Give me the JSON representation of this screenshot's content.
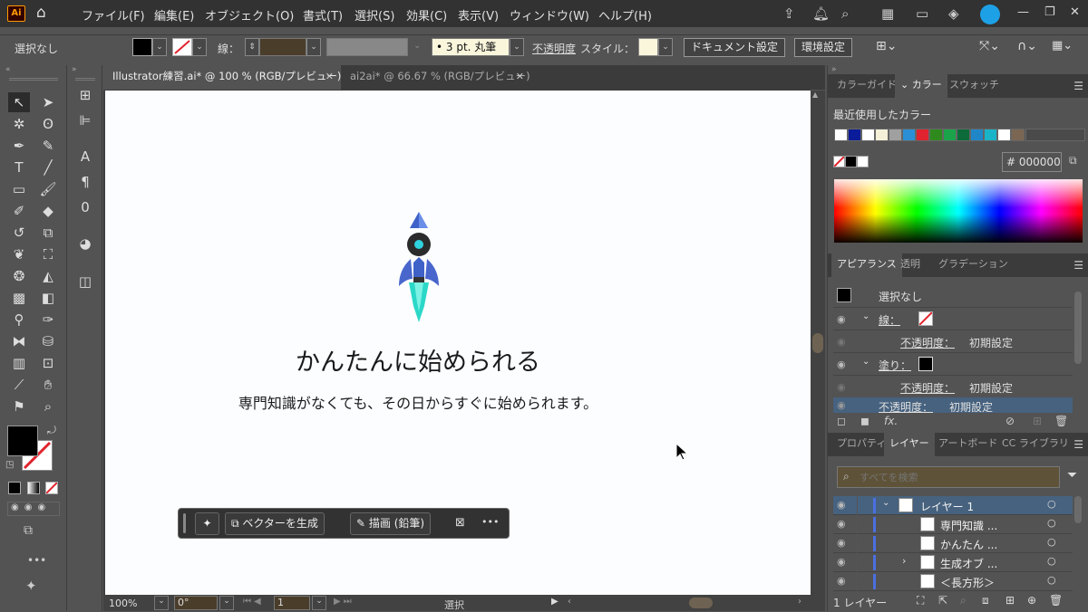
{
  "menubar": {
    "logo": "Ai",
    "items": [
      "ファイル(F)",
      "編集(E)",
      "オブジェクト(O)",
      "書式(T)",
      "選択(S)",
      "効果(C)",
      "表示(V)",
      "ウィンドウ(W)",
      "ヘルプ(H)"
    ],
    "icons": [
      "share-icon",
      "bell-icon",
      "search-icon",
      "workspace-icon",
      "arrange-icon",
      "plugin-icon",
      "profile-icon"
    ],
    "window_controls": [
      "—",
      "❐",
      "✕"
    ]
  },
  "control_bar": {
    "selection": "選択なし",
    "stroke_label": "線：",
    "stroke_size": "3 pt. 丸筆",
    "opacity_label": "不透明度",
    "style_label": "スタイル：",
    "doc_settings": "ドキュメント設定",
    "env_settings": "環境設定"
  },
  "tabs": [
    {
      "label": "Illustrator練習.ai* @ 100 % (RGB/プレビュー)",
      "active": true
    },
    {
      "label": "ai2ai* @ 66.67 % (RGB/プレビュー)",
      "active": false
    }
  ],
  "canvas": {
    "title": "かんたんに始められる",
    "subtitle": "専門知識がなくても、その日からすぐに始められます。"
  },
  "float_toolbar": {
    "generate_vector": "ベクターを生成",
    "draw_pencil": "描画 (鉛筆)",
    "more": "•••"
  },
  "status_bar": {
    "zoom": "100%",
    "rotation": "0°",
    "artboard": "1",
    "tool": "選択"
  },
  "color_panel": {
    "tabs": [
      "カラーガイド",
      "カラー",
      "スウォッチ"
    ],
    "recent_label": "最近使用したカラー",
    "recent_colors": [
      "#ffffff",
      "#0a1c9a",
      "#ffffff",
      "#f5f0d8",
      "#a0a0a0",
      "#2b8fd6",
      "#e0232e",
      "#2f8a1e",
      "#1aa34a",
      "#0c6b3a",
      "#1f87c8",
      "#1ab4c8",
      "#ffffff",
      "#7a6652"
    ],
    "hex_prefix": "#",
    "hex": "000000"
  },
  "appearance_panel": {
    "tabs": [
      "アピアランス",
      "透明",
      "グラデーション"
    ],
    "selection": "選択なし",
    "stroke": "線：",
    "opacity": "不透明度：",
    "default": "初期設定",
    "fill": "塗り：",
    "fx": "fx."
  },
  "layers_panel": {
    "tabs": [
      "プロパティ",
      "レイヤー",
      "アートボード",
      "CC ライブラリ"
    ],
    "search_placeholder": "すべてを検索",
    "layers": [
      {
        "name": "レイヤー 1",
        "selected": true
      },
      {
        "name": "専門知識 ..."
      },
      {
        "name": "かんたん ..."
      },
      {
        "name": "生成オブ ..."
      },
      {
        "name": "＜長方形＞"
      }
    ],
    "footer": "1 レイヤー"
  }
}
